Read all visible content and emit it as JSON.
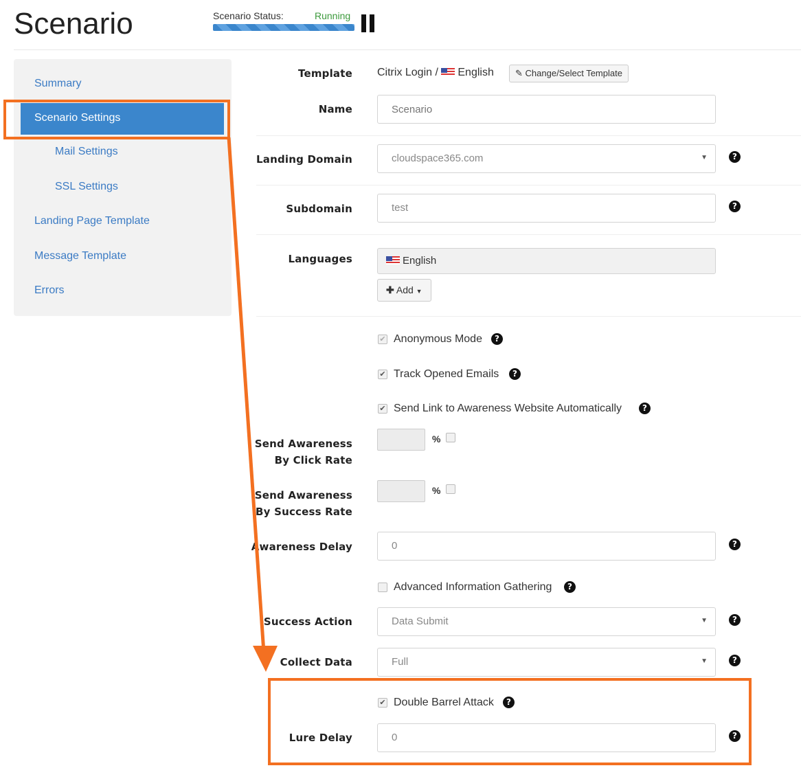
{
  "header": {
    "title": "Scenario",
    "status_label": "Scenario Status:",
    "status_value": "Running"
  },
  "sidebar": {
    "items": [
      {
        "label": "Summary"
      },
      {
        "label": "Scenario Settings"
      },
      {
        "label": "Mail Settings"
      },
      {
        "label": "SSL Settings"
      },
      {
        "label": "Landing Page Template"
      },
      {
        "label": "Message Template"
      },
      {
        "label": "Errors"
      }
    ]
  },
  "form": {
    "template_label": "Template",
    "template_value": "Citrix Login /",
    "template_lang": "English",
    "change_template_button": "Change/Select Template",
    "name_label": "Name",
    "name_placeholder": "Scenario",
    "landing_domain_label": "Landing Domain",
    "landing_domain_value": "cloudspace365.com",
    "subdomain_label": "Subdomain",
    "subdomain_value": "test",
    "languages_label": "Languages",
    "languages_value": "English",
    "add_button": "Add",
    "anonymous_mode": "Anonymous Mode",
    "track_opened": "Track Opened Emails",
    "send_link": "Send Link to Awareness Website Automatically",
    "click_rate_label_1": "Send Awareness",
    "click_rate_label_2": "By Click Rate",
    "success_rate_label_1": "Send Awareness",
    "success_rate_label_2": "By Success Rate",
    "percent": "%",
    "awareness_delay_label": "Awareness Delay",
    "awareness_delay_value": "0",
    "advanced_info": "Advanced Information Gathering",
    "success_action_label": "Success Action",
    "success_action_value": "Data Submit",
    "collect_data_label": "Collect Data",
    "collect_data_value": "Full",
    "double_barrel": "Double Barrel Attack",
    "lure_delay_label": "Lure Delay",
    "lure_delay_value": "0"
  },
  "colors": {
    "accent": "#3b86cc",
    "callout": "#f37021",
    "status_running": "#3c9a3c"
  }
}
